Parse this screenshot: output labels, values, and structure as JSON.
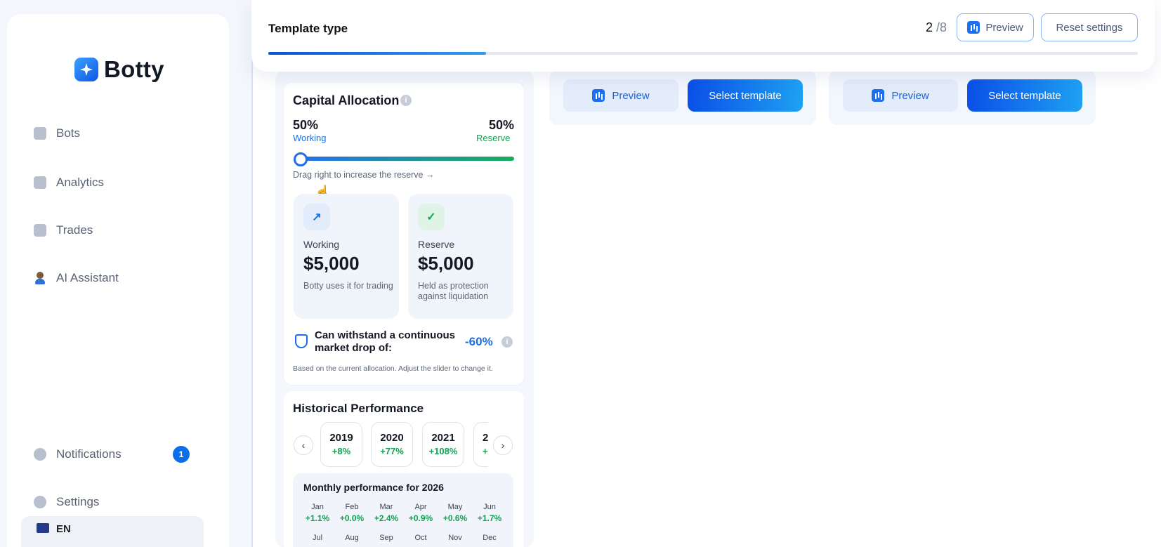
{
  "app": {
    "name": "Botty"
  },
  "sidebar": {
    "items": [
      {
        "label": "Bots",
        "icon": "bots-icon"
      },
      {
        "label": "Analytics",
        "icon": "analytics-icon"
      },
      {
        "label": "Trades",
        "icon": "trades-icon"
      },
      {
        "label": "AI Assistant",
        "icon": "ai-assistant-icon"
      }
    ],
    "notifications": {
      "label": "Notifications",
      "count": "1"
    },
    "settings": {
      "label": "Settings"
    },
    "language": {
      "label": "EN"
    }
  },
  "topbar": {
    "title": "Template type",
    "step_current": "2",
    "step_total": "/8",
    "preview_label": "Preview",
    "reset_label": "Reset settings",
    "progress_fraction": 0.25
  },
  "templates": [
    {
      "preview_label": "Preview",
      "select_label": "Select template"
    },
    {
      "preview_label": "Preview",
      "select_label": "Select template"
    }
  ],
  "capital": {
    "title": "Capital Allocation",
    "info": "i",
    "working_pct": "50%",
    "working_label": "Working",
    "reserve_pct": "50%",
    "reserve_label": "Reserve",
    "slider_value": 0,
    "hint": "Drag right to increase the reserve →",
    "working_card": {
      "label": "Working",
      "value": "$5,000",
      "desc": "Botty uses it for trading"
    },
    "reserve_card": {
      "label": "Reserve",
      "value": "$5,000",
      "desc": "Held as protection against liquidation"
    },
    "drop_text": "Can withstand a continuous market drop of:",
    "drop_value": "-60%",
    "note": "Based on the current allocation. Adjust the slider to change it."
  },
  "history": {
    "title": "Historical Performance",
    "years": [
      {
        "year": "2019",
        "pct": "+8%"
      },
      {
        "year": "2020",
        "pct": "+77%"
      },
      {
        "year": "2021",
        "pct": "+108%"
      },
      {
        "year": "2",
        "pct": "+"
      }
    ],
    "monthly_title": "Monthly performance for 2026",
    "months": [
      {
        "name": "Jan",
        "pct": "+1.1%"
      },
      {
        "name": "Feb",
        "pct": "+0.0%"
      },
      {
        "name": "Mar",
        "pct": "+2.4%"
      },
      {
        "name": "Apr",
        "pct": "+0.9%"
      },
      {
        "name": "May",
        "pct": "+0.6%"
      },
      {
        "name": "Jun",
        "pct": "+1.7%"
      },
      {
        "name": "Jul",
        "pct": ""
      },
      {
        "name": "Aug",
        "pct": ""
      },
      {
        "name": "Sep",
        "pct": ""
      },
      {
        "name": "Oct",
        "pct": ""
      },
      {
        "name": "Nov",
        "pct": ""
      },
      {
        "name": "Dec",
        "pct": ""
      }
    ]
  },
  "colors": {
    "accent": "#1e6df0",
    "positive": "#12a150",
    "reserve": "#18ad5a"
  }
}
